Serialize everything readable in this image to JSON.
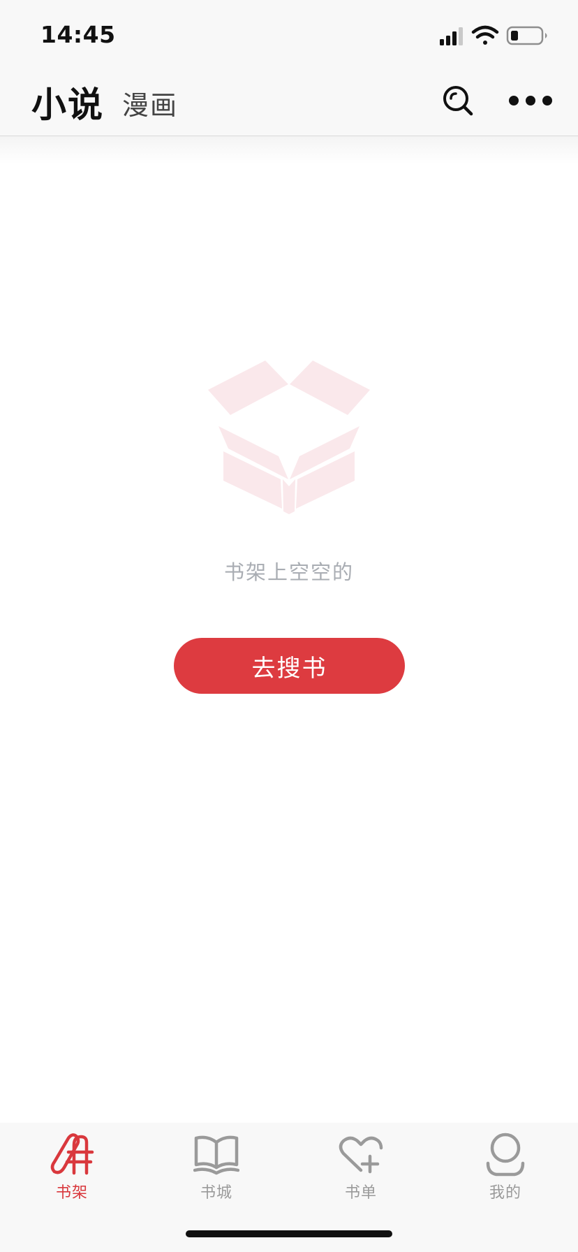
{
  "status_bar": {
    "time": "14:45",
    "icons": [
      "cellular-signal-icon",
      "wifi-icon",
      "battery-icon"
    ]
  },
  "header": {
    "tabs": [
      {
        "label": "小说",
        "active": true
      },
      {
        "label": "漫画",
        "active": false
      }
    ],
    "actions": [
      "search-icon",
      "more-icon"
    ]
  },
  "empty_state": {
    "illustration": "empty-box-icon",
    "message": "书架上空空的",
    "button_label": "去搜书"
  },
  "tab_bar": {
    "items": [
      {
        "label": "书架",
        "icon": "bookshelf-icon",
        "active": true
      },
      {
        "label": "书城",
        "icon": "open-book-icon",
        "active": false
      },
      {
        "label": "书单",
        "icon": "heart-plus-icon",
        "active": false
      },
      {
        "label": "我的",
        "icon": "user-icon",
        "active": false
      }
    ]
  },
  "colors": {
    "accent": "#dd3b40",
    "muted_text": "#a9adb3",
    "tab_inactive": "#9a9a9a",
    "illustration": "#fae8eb"
  }
}
